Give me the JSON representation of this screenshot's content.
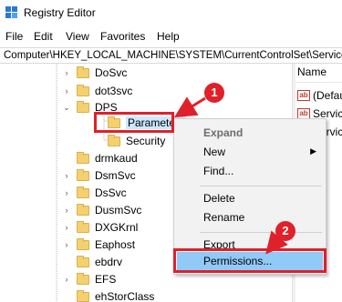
{
  "window": {
    "title": "Registry Editor"
  },
  "menu": [
    "File",
    "Edit",
    "View",
    "Favorites",
    "Help"
  ],
  "address": "Computer\\HKEY_LOCAL_MACHINE\\SYSTEM\\CurrentControlSet\\Services",
  "tree": {
    "items": [
      "DoSvc",
      "dot3svc",
      "DPS",
      "Parameters",
      "Security",
      "drmkaud",
      "DsmSvc",
      "DsSvc",
      "DusmSvc",
      "DXGKrnl",
      "Eaphost",
      "ebdrv",
      "EFS",
      "ehStorClass"
    ]
  },
  "values_pane": {
    "header": "Name",
    "rows": [
      "(Default)",
      "Service",
      "Service"
    ]
  },
  "context_menu": {
    "expand": "Expand",
    "new": "New",
    "find": "Find...",
    "delete": "Delete",
    "rename": "Rename",
    "export": "Export",
    "permissions": "Permissions..."
  },
  "annotations": {
    "step1": "1",
    "step2": "2",
    "color": "#e0202a"
  }
}
